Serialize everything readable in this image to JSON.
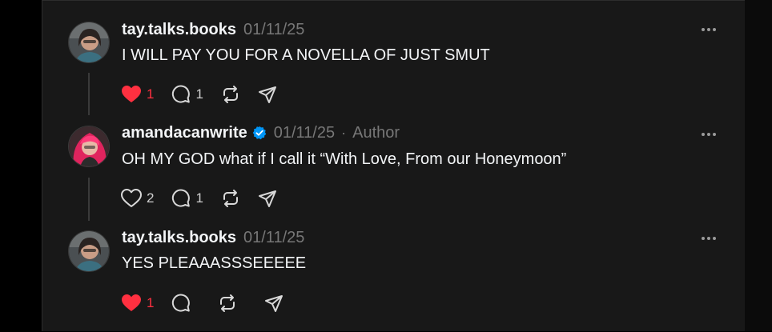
{
  "comments": [
    {
      "username": "tay.talks.books",
      "timestamp": "01/11/25",
      "author_tag": "",
      "verified": false,
      "text": "I WILL PAY YOU FOR A NOVELLA OF JUST SMUT",
      "liked": true,
      "likes": "1",
      "replies": "1",
      "avatar": "avatar-tay"
    },
    {
      "username": "amandacanwrite",
      "timestamp": "01/11/25",
      "separator": "·",
      "author_tag": "Author",
      "verified": true,
      "text": "OH MY GOD what if I call it “With Love, From our Honeymoon”",
      "liked": false,
      "likes": "2",
      "replies": "1",
      "avatar": "avatar-amanda"
    },
    {
      "username": "tay.talks.books",
      "timestamp": "01/11/25",
      "author_tag": "",
      "verified": false,
      "text": "YES PLEAAASSSEEEEE",
      "liked": true,
      "likes": "1",
      "replies": "",
      "avatar": "avatar-tay"
    }
  ],
  "icons": {
    "like": "heart-icon",
    "reply": "comment-bubble-icon",
    "repost": "repost-icon",
    "share": "send-icon",
    "more": "more-dots-icon",
    "verified": "verified-badge-icon"
  },
  "colors": {
    "background": "#181818",
    "text": "#f3f5f7",
    "muted": "#777777",
    "like_active": "#ff3040",
    "verified": "#0095f6"
  }
}
